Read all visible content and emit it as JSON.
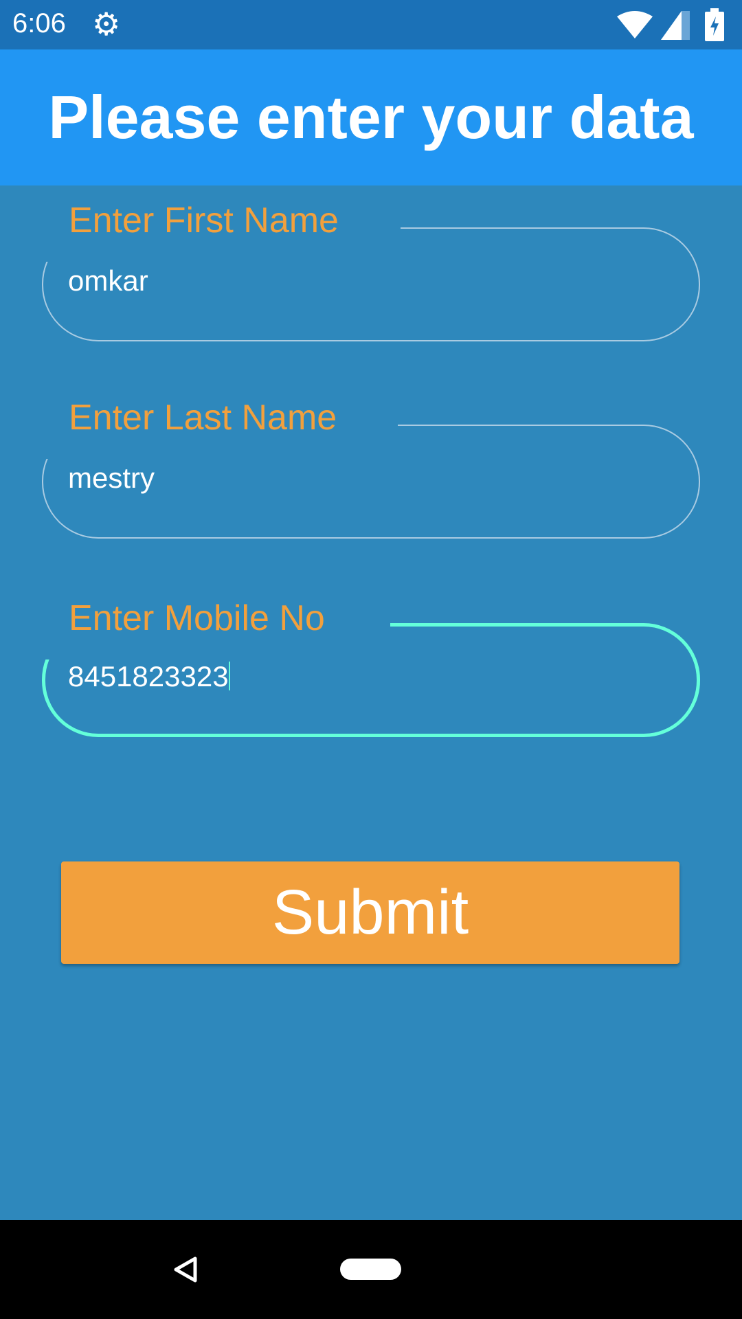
{
  "status_bar": {
    "time": "6:06",
    "icons": [
      "gear-icon",
      "wifi-icon",
      "signal-icon",
      "battery-charging-icon"
    ]
  },
  "app_bar": {
    "title": "Please enter your data"
  },
  "form": {
    "fields": [
      {
        "label": "Enter First Name",
        "value": "omkar"
      },
      {
        "label": "Enter Last Name",
        "value": "mestry"
      },
      {
        "label": "Enter Mobile No",
        "value": "8451823323"
      }
    ],
    "submit_label": "Submit"
  },
  "colors": {
    "accent": "#f2a03d",
    "focus": "#64ffda",
    "app_bar": "#2196f3",
    "background": "#2e88bc"
  }
}
